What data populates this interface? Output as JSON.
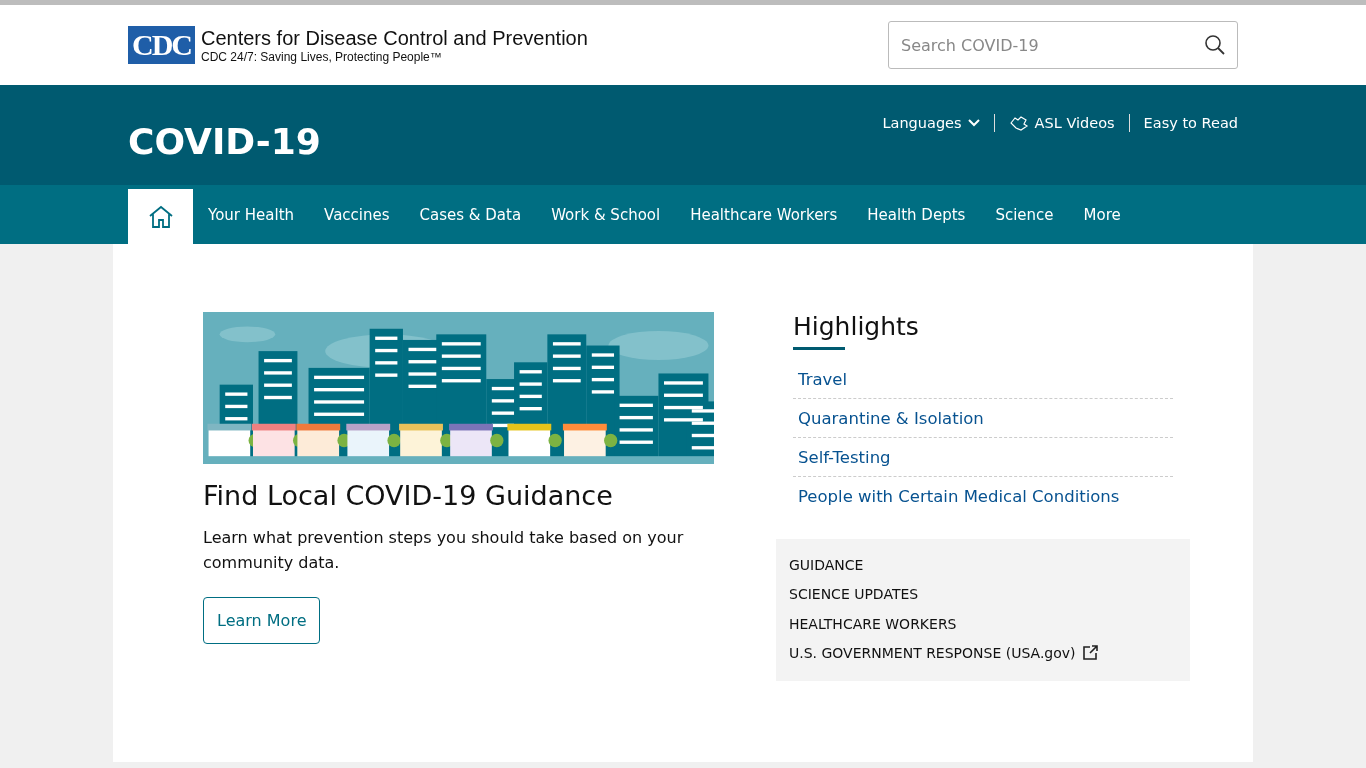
{
  "header": {
    "logo_text": "CDC",
    "org_name": "Centers for Disease Control and Prevention",
    "tagline": "CDC 24/7: Saving Lives, Protecting People™",
    "search": {
      "placeholder": "Search COVID-19"
    }
  },
  "banner": {
    "title": "COVID-19",
    "links": [
      {
        "kind": "dropdown",
        "label": "Languages"
      },
      {
        "kind": "asl",
        "label": "ASL Videos"
      },
      {
        "kind": "plain",
        "label": "Easy to Read"
      }
    ]
  },
  "nav": [
    {
      "kind": "home",
      "selected": true
    },
    {
      "kind": "text",
      "label": "Your Health",
      "selected": false
    },
    {
      "kind": "text",
      "label": "Vaccines",
      "selected": false
    },
    {
      "kind": "text",
      "label": "Cases & Data",
      "selected": false
    },
    {
      "kind": "text",
      "label": "Work & School",
      "selected": false
    },
    {
      "kind": "text",
      "label": "Healthcare Workers",
      "selected": false
    },
    {
      "kind": "text",
      "label": "Health Depts",
      "selected": false
    },
    {
      "kind": "text",
      "label": "Science",
      "selected": false
    },
    {
      "kind": "text",
      "label": "More",
      "selected": false
    }
  ],
  "feature": {
    "heading": "Find Local COVID-19 Guidance",
    "body": "Learn what prevention steps you should take based on your community data.",
    "button": "Learn More"
  },
  "highlights": {
    "heading": "Highlights",
    "links": [
      "Travel",
      "Quarantine & Isolation",
      "Self-Testing",
      "People with Certain Medical Conditions"
    ]
  },
  "quick_links": [
    {
      "label": "GUIDANCE",
      "external": false
    },
    {
      "label": "SCIENCE UPDATES",
      "external": false
    },
    {
      "label": "HEALTHCARE WORKERS",
      "external": false
    },
    {
      "label": "U.S. GOVERNMENT RESPONSE (USA.gov)",
      "external": true
    }
  ]
}
